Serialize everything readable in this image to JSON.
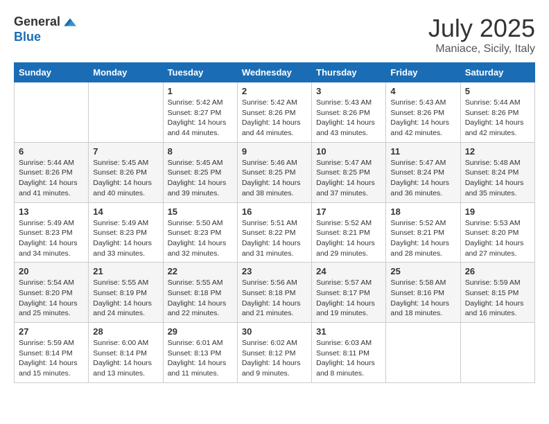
{
  "logo": {
    "general": "General",
    "blue": "Blue"
  },
  "header": {
    "month": "July 2025",
    "location": "Maniace, Sicily, Italy"
  },
  "weekdays": [
    "Sunday",
    "Monday",
    "Tuesday",
    "Wednesday",
    "Thursday",
    "Friday",
    "Saturday"
  ],
  "weeks": [
    [
      {
        "day": "",
        "sunrise": "",
        "sunset": "",
        "daylight": ""
      },
      {
        "day": "",
        "sunrise": "",
        "sunset": "",
        "daylight": ""
      },
      {
        "day": "1",
        "sunrise": "Sunrise: 5:42 AM",
        "sunset": "Sunset: 8:27 PM",
        "daylight": "Daylight: 14 hours and 44 minutes."
      },
      {
        "day": "2",
        "sunrise": "Sunrise: 5:42 AM",
        "sunset": "Sunset: 8:26 PM",
        "daylight": "Daylight: 14 hours and 44 minutes."
      },
      {
        "day": "3",
        "sunrise": "Sunrise: 5:43 AM",
        "sunset": "Sunset: 8:26 PM",
        "daylight": "Daylight: 14 hours and 43 minutes."
      },
      {
        "day": "4",
        "sunrise": "Sunrise: 5:43 AM",
        "sunset": "Sunset: 8:26 PM",
        "daylight": "Daylight: 14 hours and 42 minutes."
      },
      {
        "day": "5",
        "sunrise": "Sunrise: 5:44 AM",
        "sunset": "Sunset: 8:26 PM",
        "daylight": "Daylight: 14 hours and 42 minutes."
      }
    ],
    [
      {
        "day": "6",
        "sunrise": "Sunrise: 5:44 AM",
        "sunset": "Sunset: 8:26 PM",
        "daylight": "Daylight: 14 hours and 41 minutes."
      },
      {
        "day": "7",
        "sunrise": "Sunrise: 5:45 AM",
        "sunset": "Sunset: 8:26 PM",
        "daylight": "Daylight: 14 hours and 40 minutes."
      },
      {
        "day": "8",
        "sunrise": "Sunrise: 5:45 AM",
        "sunset": "Sunset: 8:25 PM",
        "daylight": "Daylight: 14 hours and 39 minutes."
      },
      {
        "day": "9",
        "sunrise": "Sunrise: 5:46 AM",
        "sunset": "Sunset: 8:25 PM",
        "daylight": "Daylight: 14 hours and 38 minutes."
      },
      {
        "day": "10",
        "sunrise": "Sunrise: 5:47 AM",
        "sunset": "Sunset: 8:25 PM",
        "daylight": "Daylight: 14 hours and 37 minutes."
      },
      {
        "day": "11",
        "sunrise": "Sunrise: 5:47 AM",
        "sunset": "Sunset: 8:24 PM",
        "daylight": "Daylight: 14 hours and 36 minutes."
      },
      {
        "day": "12",
        "sunrise": "Sunrise: 5:48 AM",
        "sunset": "Sunset: 8:24 PM",
        "daylight": "Daylight: 14 hours and 35 minutes."
      }
    ],
    [
      {
        "day": "13",
        "sunrise": "Sunrise: 5:49 AM",
        "sunset": "Sunset: 8:23 PM",
        "daylight": "Daylight: 14 hours and 34 minutes."
      },
      {
        "day": "14",
        "sunrise": "Sunrise: 5:49 AM",
        "sunset": "Sunset: 8:23 PM",
        "daylight": "Daylight: 14 hours and 33 minutes."
      },
      {
        "day": "15",
        "sunrise": "Sunrise: 5:50 AM",
        "sunset": "Sunset: 8:23 PM",
        "daylight": "Daylight: 14 hours and 32 minutes."
      },
      {
        "day": "16",
        "sunrise": "Sunrise: 5:51 AM",
        "sunset": "Sunset: 8:22 PM",
        "daylight": "Daylight: 14 hours and 31 minutes."
      },
      {
        "day": "17",
        "sunrise": "Sunrise: 5:52 AM",
        "sunset": "Sunset: 8:21 PM",
        "daylight": "Daylight: 14 hours and 29 minutes."
      },
      {
        "day": "18",
        "sunrise": "Sunrise: 5:52 AM",
        "sunset": "Sunset: 8:21 PM",
        "daylight": "Daylight: 14 hours and 28 minutes."
      },
      {
        "day": "19",
        "sunrise": "Sunrise: 5:53 AM",
        "sunset": "Sunset: 8:20 PM",
        "daylight": "Daylight: 14 hours and 27 minutes."
      }
    ],
    [
      {
        "day": "20",
        "sunrise": "Sunrise: 5:54 AM",
        "sunset": "Sunset: 8:20 PM",
        "daylight": "Daylight: 14 hours and 25 minutes."
      },
      {
        "day": "21",
        "sunrise": "Sunrise: 5:55 AM",
        "sunset": "Sunset: 8:19 PM",
        "daylight": "Daylight: 14 hours and 24 minutes."
      },
      {
        "day": "22",
        "sunrise": "Sunrise: 5:55 AM",
        "sunset": "Sunset: 8:18 PM",
        "daylight": "Daylight: 14 hours and 22 minutes."
      },
      {
        "day": "23",
        "sunrise": "Sunrise: 5:56 AM",
        "sunset": "Sunset: 8:18 PM",
        "daylight": "Daylight: 14 hours and 21 minutes."
      },
      {
        "day": "24",
        "sunrise": "Sunrise: 5:57 AM",
        "sunset": "Sunset: 8:17 PM",
        "daylight": "Daylight: 14 hours and 19 minutes."
      },
      {
        "day": "25",
        "sunrise": "Sunrise: 5:58 AM",
        "sunset": "Sunset: 8:16 PM",
        "daylight": "Daylight: 14 hours and 18 minutes."
      },
      {
        "day": "26",
        "sunrise": "Sunrise: 5:59 AM",
        "sunset": "Sunset: 8:15 PM",
        "daylight": "Daylight: 14 hours and 16 minutes."
      }
    ],
    [
      {
        "day": "27",
        "sunrise": "Sunrise: 5:59 AM",
        "sunset": "Sunset: 8:14 PM",
        "daylight": "Daylight: 14 hours and 15 minutes."
      },
      {
        "day": "28",
        "sunrise": "Sunrise: 6:00 AM",
        "sunset": "Sunset: 8:14 PM",
        "daylight": "Daylight: 14 hours and 13 minutes."
      },
      {
        "day": "29",
        "sunrise": "Sunrise: 6:01 AM",
        "sunset": "Sunset: 8:13 PM",
        "daylight": "Daylight: 14 hours and 11 minutes."
      },
      {
        "day": "30",
        "sunrise": "Sunrise: 6:02 AM",
        "sunset": "Sunset: 8:12 PM",
        "daylight": "Daylight: 14 hours and 9 minutes."
      },
      {
        "day": "31",
        "sunrise": "Sunrise: 6:03 AM",
        "sunset": "Sunset: 8:11 PM",
        "daylight": "Daylight: 14 hours and 8 minutes."
      },
      {
        "day": "",
        "sunrise": "",
        "sunset": "",
        "daylight": ""
      },
      {
        "day": "",
        "sunrise": "",
        "sunset": "",
        "daylight": ""
      }
    ]
  ]
}
